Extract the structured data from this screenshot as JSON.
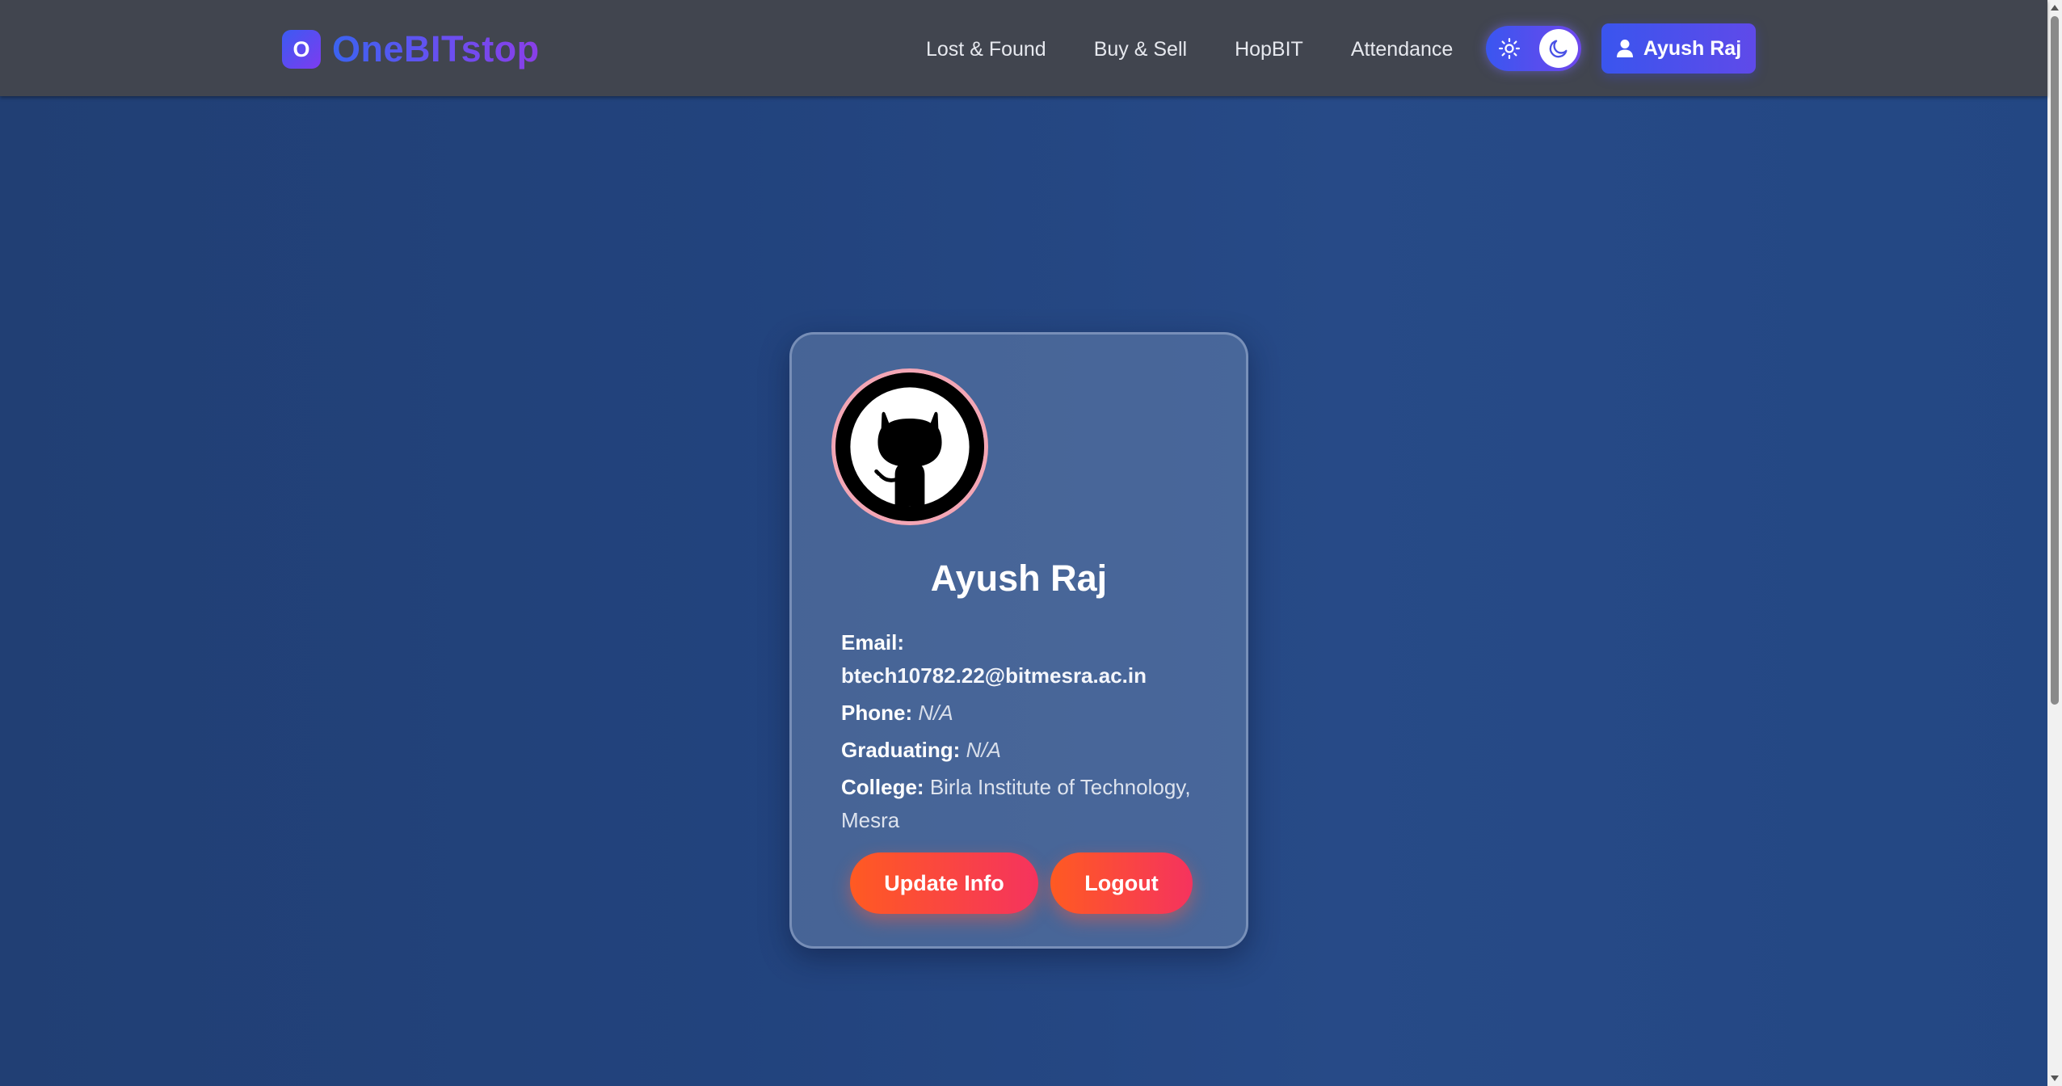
{
  "brand": {
    "badge_letter": "O",
    "name": "OneBITstop",
    "gradient_start": "#3b63f0",
    "gradient_end": "#8a3ee8"
  },
  "nav": {
    "links": [
      {
        "label": "Lost & Found"
      },
      {
        "label": "Buy & Sell"
      },
      {
        "label": "HopBIT"
      },
      {
        "label": "Attendance"
      }
    ],
    "theme_toggle": {
      "left_icon": "sun-icon",
      "right_icon": "moon-icon",
      "active": "dark"
    },
    "user_button": {
      "icon": "user-icon",
      "label": "Ayush Raj"
    }
  },
  "profile": {
    "avatar_icon": "github-octocat-icon",
    "name": "Ayush Raj",
    "fields": {
      "email": {
        "label": "Email:",
        "value": "btech10782.22@bitmesra.ac.in"
      },
      "phone": {
        "label": "Phone:",
        "value": "N/A"
      },
      "graduating": {
        "label": "Graduating:",
        "value": "N/A"
      },
      "college": {
        "label": "College:",
        "value": "Birla Institute of Technology, Mesra"
      }
    },
    "actions": {
      "update_label": "Update Info",
      "logout_label": "Logout"
    }
  },
  "colors": {
    "navbar_bg": "#41454f",
    "page_bg": "#22437d",
    "action_gradient_start": "#ff5a22",
    "action_gradient_end": "#f5335e",
    "avatar_ring": "#f3a6b5"
  }
}
